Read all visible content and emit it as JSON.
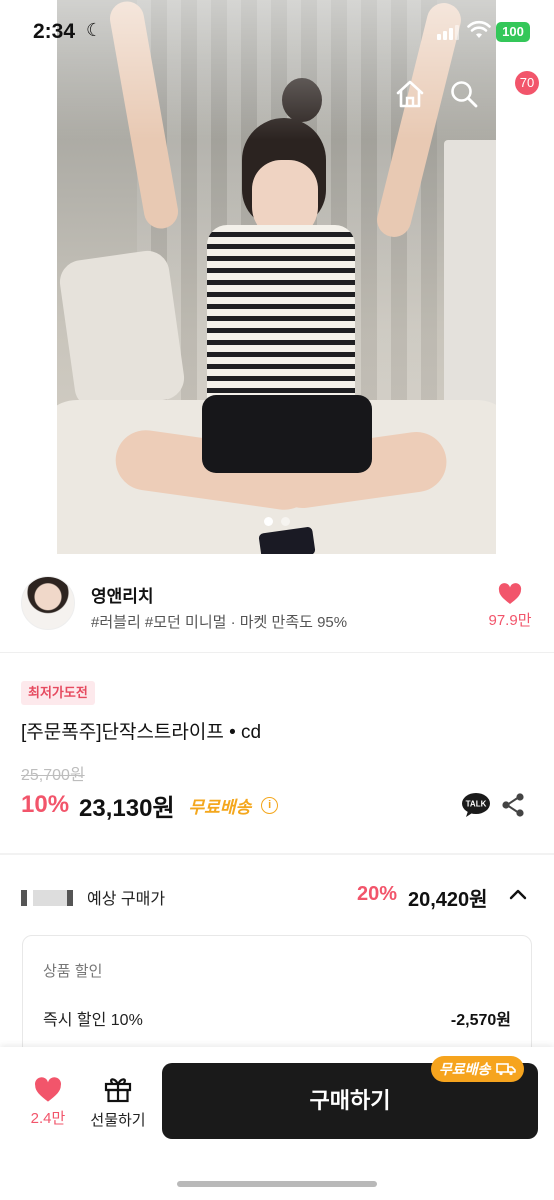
{
  "status_bar": {
    "time": "2:34",
    "battery": "100"
  },
  "nav": {
    "cart_count": "70"
  },
  "gallery": {
    "page_count": 2,
    "active_index": 0
  },
  "seller": {
    "name": "영앤리치",
    "tags": "#러블리 #모던 미니멀 · 마켓 만족도 95%",
    "likes": "97.9만"
  },
  "product": {
    "badge": "최저가도전",
    "name": "[주문폭주]단작스트라이프 • cd",
    "original_price": "25,700원",
    "discount": "10%",
    "price": "23,130원",
    "free_shipping": "무료배송"
  },
  "expected": {
    "label": "예상 구매가",
    "discount": "20%",
    "price": "20,420원"
  },
  "discount_detail": {
    "heading": "상품 할인",
    "item_label": "즉시 할인 10%",
    "item_value": "-2,570원"
  },
  "bottom_bar": {
    "likes": "2.4만",
    "gift_label": "선물하기",
    "buy_label": "구매하기",
    "ship_tag": "무료배송"
  },
  "colors": {
    "accent_pink": "#f2556b",
    "shipping_orange": "#f4a71d",
    "buy_button": "#1a1a1a"
  }
}
